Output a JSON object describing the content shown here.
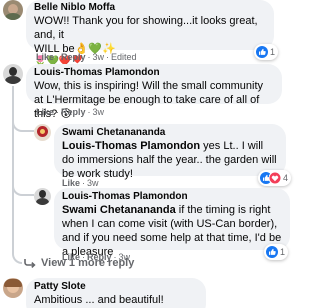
{
  "comments": [
    {
      "author": "Belle Niblo Moffa",
      "text_line1": "WOW!! Thank you for showing...it looks great, and, it",
      "text_line2_prefix": "WILL be",
      "emoji_row": "🌷💚❤️❣️",
      "meta": {
        "like": "Like",
        "reply": "Reply",
        "time": "3w",
        "edited": "Edited"
      },
      "reaction_count": "1"
    },
    {
      "author": "Louis-Thomas Plamondon",
      "text": "Wow, this is inspiring! Will the small community at L'Hermitage be enough to take care of all of this? 😮",
      "meta": {
        "like": "Like",
        "reply": "Reply",
        "time": "3w"
      }
    },
    {
      "author": "Swami Chetanananda",
      "mention": "Louis-Thomas Plamondon",
      "text": " yes Lt.. I will do immersions half the year.. the garden will be work study!",
      "meta": {
        "like": "Like",
        "time": "3w"
      },
      "reaction_count": "4"
    },
    {
      "author": "Louis-Thomas Plamondon",
      "mention": "Swami Chetanananda",
      "text": " if the timing is right when I can come visit (with US-Can border), and if you need some help at that time, I'd be a pleasure",
      "meta": {
        "like": "Like",
        "reply": "Reply",
        "time": "3w"
      },
      "reaction_count": "1"
    },
    {
      "author": "Patty Slote",
      "text": "Ambitious ... and beautiful!"
    }
  ],
  "view_more": {
    "label": "View 1 more reply"
  },
  "colors": {
    "like_blue": "#1877f2",
    "love_red": "#f33e58",
    "bubble": "#f0f2f5",
    "meta_gray": "#65676b"
  }
}
